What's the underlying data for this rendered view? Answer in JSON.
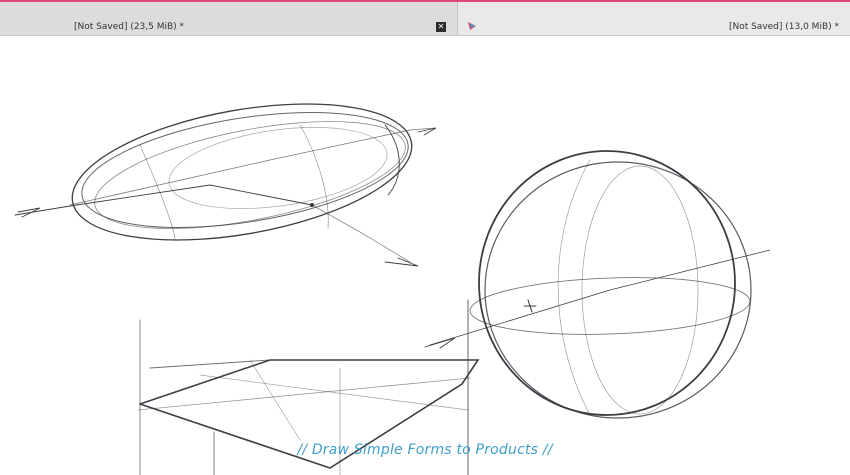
{
  "window": {
    "accent_color": "#e0457b"
  },
  "tabs": [
    {
      "title": "[Not Saved]  (23,5 MiB) *",
      "close_icon": "close-icon"
    },
    {
      "title": "[Not Saved]  (13,0 MiB) *",
      "app_icon": "krita-icon"
    }
  ],
  "canvas": {
    "caption": "// Draw Simple Forms to Products //",
    "caption_color": "#3f9fc9",
    "stroke_color": "#3b3f44"
  }
}
